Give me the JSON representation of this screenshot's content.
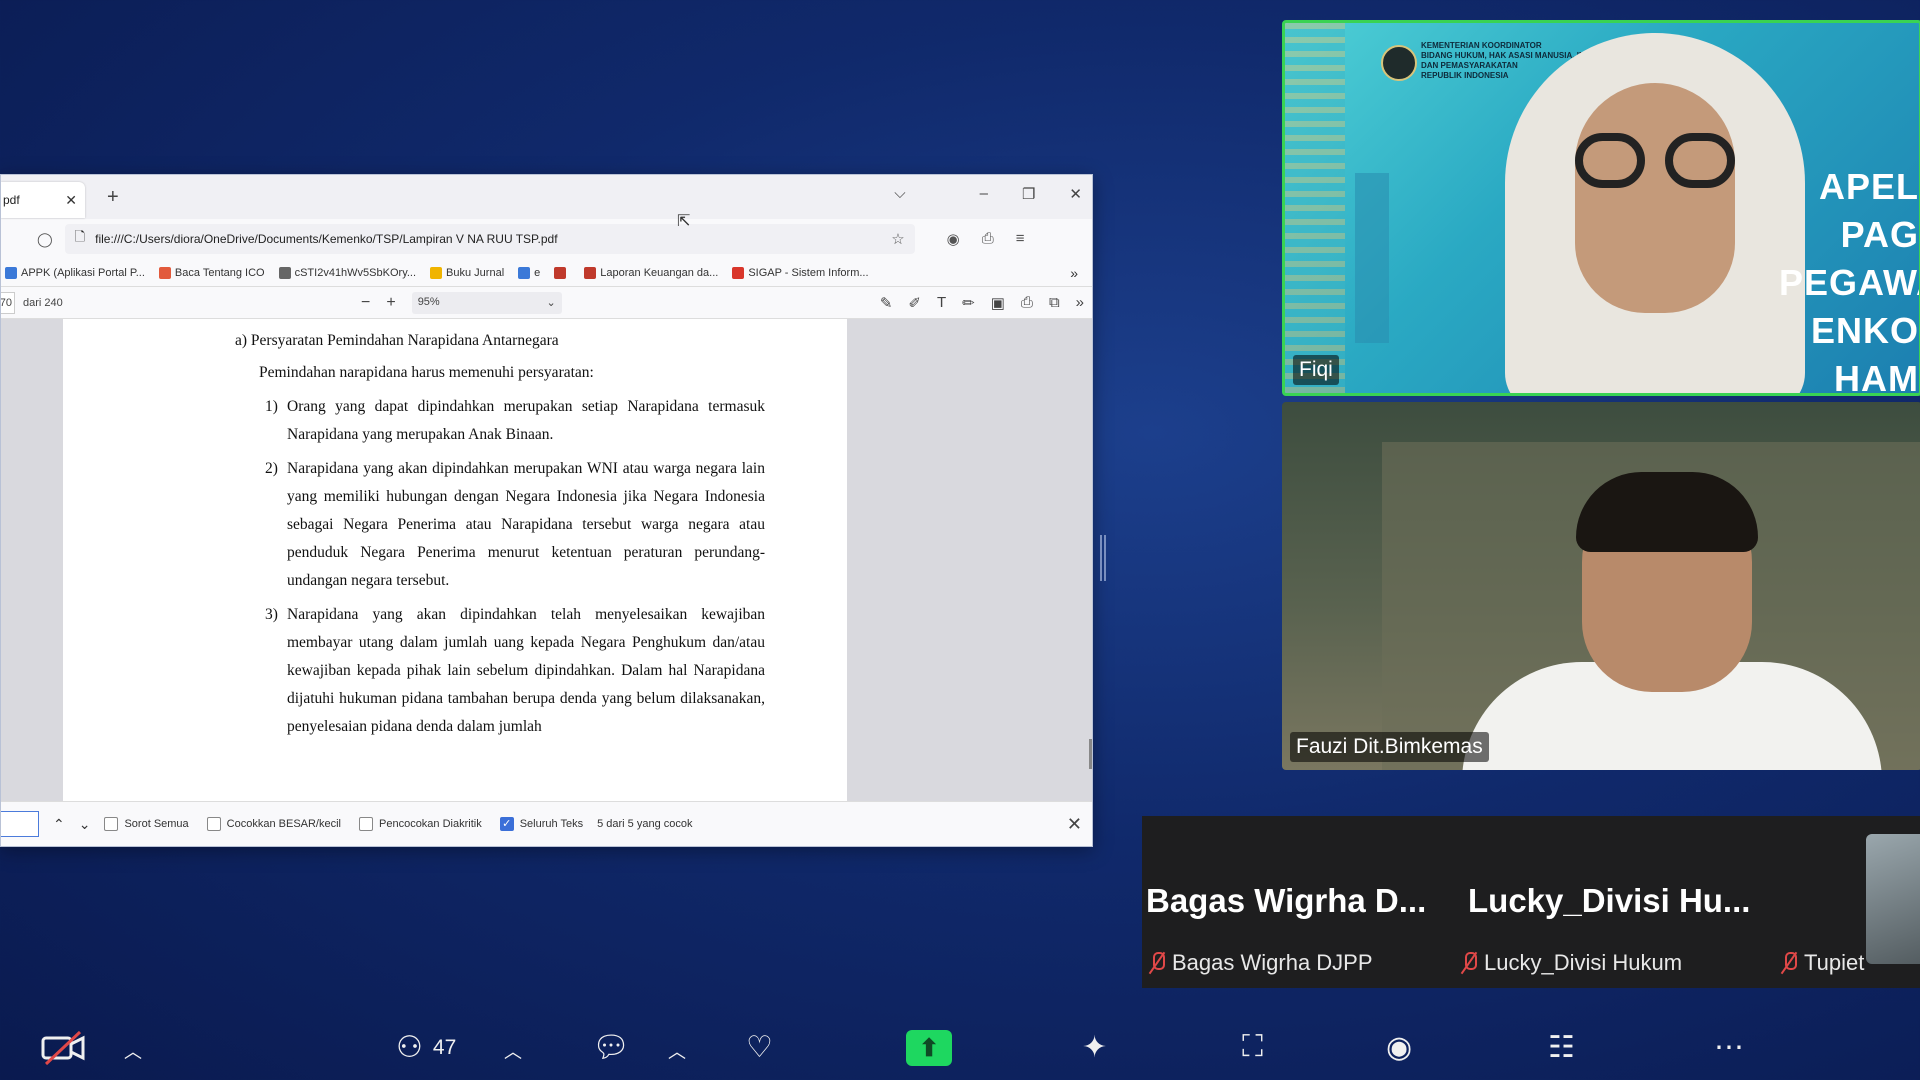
{
  "browser": {
    "tab_title": "pdf",
    "tab_close": "✕",
    "new_tab": "+",
    "url": "file:///C:/Users/diora/OneDrive/Documents/Kemenko/TSP/Lampiran V NA RUU TSP.pdf",
    "bookmarks": [
      {
        "label": "APPK (Aplikasi Portal P...",
        "color": "#3b79d8"
      },
      {
        "label": "Baca Tentang ICO",
        "color": "#e25a3c"
      },
      {
        "label": "cSTI2v41hWv5SbKOry...",
        "color": "#666666"
      },
      {
        "label": "Buku Jurnal",
        "color": "#f0b400"
      },
      {
        "label": "e",
        "color": "#3b79d8"
      },
      {
        "label": "",
        "color": "#c0392b"
      },
      {
        "label": "Laporan Keuangan da...",
        "color": "#c0392b"
      },
      {
        "label": "SIGAP - Sistem Inform...",
        "color": "#d9362b"
      }
    ]
  },
  "pdf_toolbar": {
    "page_current": "70",
    "page_total": "dari 240",
    "zoom": "95%"
  },
  "pdf": {
    "heading": "a)  Persyaratan Pemindahan Narapidana Antarnegara",
    "intro": "Pemindahan narapidana harus memenuhi persyaratan:",
    "items": [
      {
        "num": "1)",
        "text": "Orang yang dapat dipindahkan merupakan setiap Narapidana termasuk Narapidana yang merupakan Anak Binaan."
      },
      {
        "num": "2)",
        "text": "Narapidana yang akan dipindahkan merupakan WNI atau warga negara lain yang memiliki hubungan dengan Negara Indonesia jika Negara Indonesia sebagai Negara Penerima atau Narapidana tersebut warga negara atau penduduk Negara Penerima menurut ketentuan peraturan perundang-undangan negara tersebut."
      },
      {
        "num": "3)",
        "text": "Narapidana yang akan dipindahkan telah menyelesaikan kewajiban membayar utang dalam jumlah uang kepada Negara Penghukum dan/atau kewajiban kepada pihak lain sebelum dipindahkan. Dalam hal Narapidana dijatuhi hukuman pidana tambahan berupa denda yang belum dilaksanakan, penyelesaian pidana denda dalam jumlah"
      }
    ]
  },
  "findbar": {
    "options": [
      {
        "label": "Sorot Semua",
        "checked": false
      },
      {
        "label": "Cocokkan BESAR/kecil",
        "checked": false
      },
      {
        "label": "Pencocokan Diakritik",
        "checked": false
      },
      {
        "label": "Seluruh Teks",
        "checked": true
      }
    ],
    "match_status": "5 dari 5 yang cocok"
  },
  "videos": {
    "top": {
      "name": "Fiqi",
      "banner": "APEL PAG\nPEGAWA\nENKO\nHAM\nIPAS",
      "ministry": "KEMENTERIAN KOORDINATOR\nBIDANG HUKUM, HAK ASASI MANUSIA, IMIGRASI\nDAN PEMASYARAKATAN\nREPUBLIK INDONESIA"
    },
    "bottom": {
      "name": "Fauzi Dit.Bimkemas"
    }
  },
  "strip": {
    "big_names": [
      "Bagas Wigrha D...",
      "Lucky_Divisi Hu..."
    ],
    "participants": [
      "Bagas Wigrha DJPP",
      "Lucky_Divisi Hukum",
      "Tupiet"
    ]
  },
  "toolbar": {
    "participant_count": "47"
  },
  "colors": {
    "active_speaker": "#39d353",
    "share_button": "#1ed760",
    "muted_mic": "#e04848"
  }
}
